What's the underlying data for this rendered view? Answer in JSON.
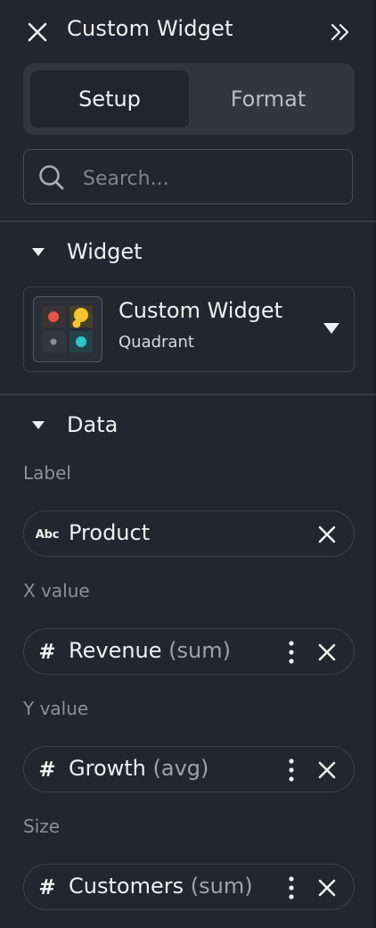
{
  "header": {
    "title": "Custom Widget",
    "close_icon": "close-icon",
    "collapse_icon": "double-chevron-right-icon"
  },
  "tabs": [
    {
      "label": "Setup",
      "active": true
    },
    {
      "label": "Format",
      "active": false
    }
  ],
  "search": {
    "placeholder": "Search...",
    "value": ""
  },
  "widget_section": {
    "label": "Widget",
    "selected": {
      "name": "Custom Widget",
      "subtype": "Quadrant"
    }
  },
  "data_section": {
    "label": "Data",
    "fields": [
      {
        "label": "Label",
        "type_icon": "Abc",
        "field": "Product",
        "aggregation": "",
        "has_menu": false
      },
      {
        "label": "X value",
        "type_icon": "#",
        "field": "Revenue",
        "aggregation": "(sum)",
        "has_menu": true
      },
      {
        "label": "Y value",
        "type_icon": "#",
        "field": "Growth",
        "aggregation": "(avg)",
        "has_menu": true
      },
      {
        "label": "Size",
        "type_icon": "#",
        "field": "Customers",
        "aggregation": "(sum)",
        "has_menu": true
      }
    ]
  },
  "colors": {
    "background": "#23252f",
    "tab_track": "#33363f",
    "tab_active": "#23252e",
    "border": "#3f424d",
    "muted_text": "#8c909b",
    "quadrant_red": "#e5534b",
    "quadrant_yellow": "#f5c531",
    "quadrant_grey": "#8a8e99",
    "quadrant_teal": "#2ec4c8"
  }
}
